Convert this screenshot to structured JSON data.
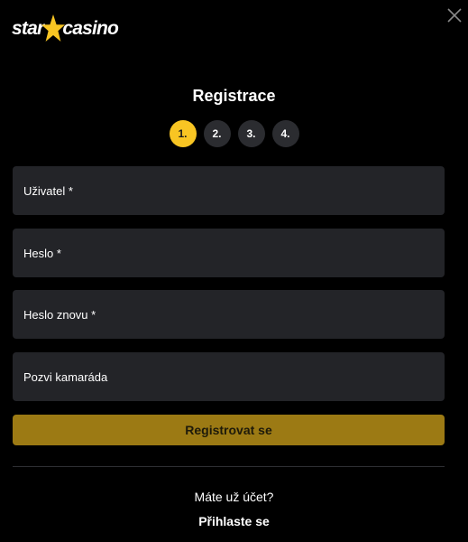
{
  "logo": {
    "part1": "star",
    "part2": "casino",
    "star_color": "#f8c523",
    "icon": "star-icon"
  },
  "close": {
    "icon": "close-icon",
    "color": "#8a8a8a"
  },
  "title": "Registrace",
  "steps": [
    {
      "label": "1.",
      "active": true
    },
    {
      "label": "2.",
      "active": false
    },
    {
      "label": "3.",
      "active": false
    },
    {
      "label": "4.",
      "active": false
    }
  ],
  "form": {
    "username": {
      "placeholder": "Uživatel *",
      "value": ""
    },
    "password": {
      "placeholder": "Heslo *",
      "value": ""
    },
    "password_repeat": {
      "placeholder": "Heslo znovu *",
      "value": ""
    },
    "invite_friend": {
      "placeholder": "Pozvi kamaráda",
      "value": ""
    }
  },
  "register_button": "Registrovat se",
  "footer": {
    "question": "Máte už účet?",
    "login_link": "Přihlaste se"
  },
  "colors": {
    "background": "#000000",
    "field_bg": "#232428",
    "accent": "#f8c523",
    "button_bg": "#9c7a14",
    "step_inactive": "#2b2c30"
  }
}
